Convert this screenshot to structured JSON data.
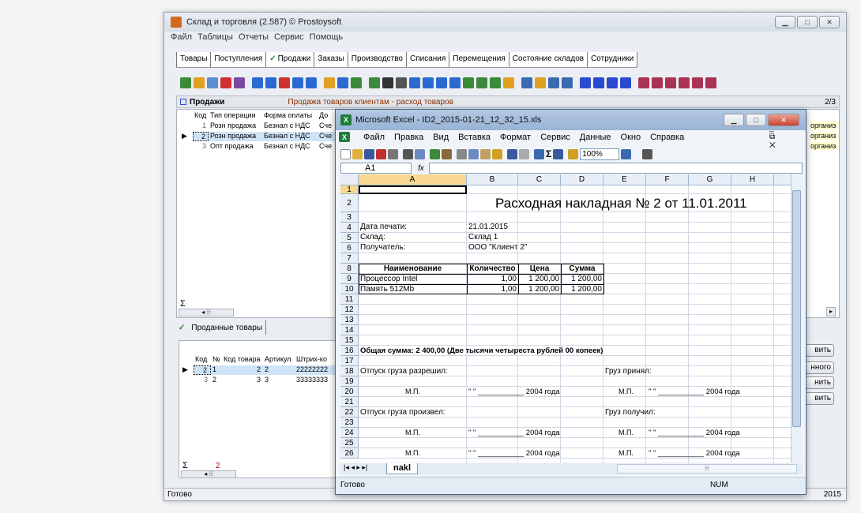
{
  "main": {
    "title": "Склад и торговля (2.587) © Prostoysoft",
    "menu": [
      "Файл",
      "Таблицы",
      "Отчеты",
      "Сервис",
      "Помощь"
    ],
    "tabs": [
      "Товары",
      "Поступления",
      "Продажи",
      "Заказы",
      "Производство",
      "Списания",
      "Перемещения",
      "Состояние складов",
      "Сотрудники"
    ],
    "panel_title": "Продажи",
    "panel_subtitle": "Продажа товаров клиентам - расход товаров",
    "panel_count": "2/3",
    "grid_headers": [
      "Код",
      "Тип операции",
      "Форма оплаты",
      "До"
    ],
    "grid_rows": [
      {
        "code": "1",
        "type": "Розн продажа",
        "pay": "Безнал с НДС",
        "doc": "Сче"
      },
      {
        "code": "2",
        "type": "Розн продажа",
        "pay": "Безнал с НДС",
        "doc": "Сче"
      },
      {
        "code": "3",
        "type": "Опт продажа",
        "pay": "Безнал с НДС",
        "doc": "Сче"
      }
    ],
    "right_cut_texts": [
      "организ",
      "организ",
      "организ"
    ],
    "sigma": "Σ",
    "bottom_tab": "Проданные товары",
    "sub_headers": [
      "Код",
      "№",
      "Код товара",
      "Артикул",
      "Штрих-ко"
    ],
    "sub_rows": [
      {
        "code": "2",
        "n": "1",
        "goods": "2",
        "art": "2",
        "bar": "22222222"
      },
      {
        "code": "3",
        "n": "2",
        "goods": "3",
        "art": "3",
        "bar": "33333333"
      }
    ],
    "sub_sum": "2",
    "side_buttons": [
      "вить",
      "нного",
      "нить",
      "вить"
    ],
    "status": "Готово",
    "status_year": "2015"
  },
  "excel": {
    "title": "Microsoft Excel - ID2_2015-01-21_12_32_15.xls",
    "menu": [
      "Файл",
      "Правка",
      "Вид",
      "Вставка",
      "Формат",
      "Сервис",
      "Данные",
      "Окно",
      "Справка"
    ],
    "zoom": "100%",
    "namebox": "A1",
    "fx": "fx",
    "columns": [
      "A",
      "B",
      "C",
      "D",
      "E",
      "F",
      "G",
      "H"
    ],
    "rows": [
      "1",
      "2",
      "3",
      "4",
      "5",
      "6",
      "7",
      "8",
      "9",
      "10",
      "11",
      "12",
      "13",
      "14",
      "15",
      "16",
      "17",
      "18",
      "19",
      "20",
      "21",
      "22",
      "23",
      "24",
      "25",
      "26"
    ],
    "doc_title": "Расходная накладная № 2 от 11.01.2011",
    "print_date_label": "Дата печати:",
    "print_date": "21.01.2015",
    "warehouse_label": "Склад:",
    "warehouse": "Склад 1",
    "receiver_label": "Получатель:",
    "receiver": "ООО \"Клиент 2\"",
    "table_headers": [
      "Наименование",
      "Количество",
      "Цена",
      "Сумма"
    ],
    "table_rows": [
      {
        "name": "Процессор Intel",
        "qty": "1,00",
        "price": "1 200,00",
        "sum": "1 200,00"
      },
      {
        "name": "Память 512Mb",
        "qty": "1,00",
        "price": "1 200,00",
        "sum": "1 200,00"
      }
    ],
    "total": "Общая сумма: 2 400,00 (Две тысячи четыреста рублей 00 копеек)",
    "allowed": "Отпуск груза разрешил:",
    "accepted": "Груз принял:",
    "produced": "Отпуск груза произвел:",
    "received": "Груз получил:",
    "mp": "М.П.",
    "date_line": "\"  \"  ___________ 2004 года",
    "sheet_tab": "nakl",
    "status": "Готово",
    "num": "NUM"
  }
}
